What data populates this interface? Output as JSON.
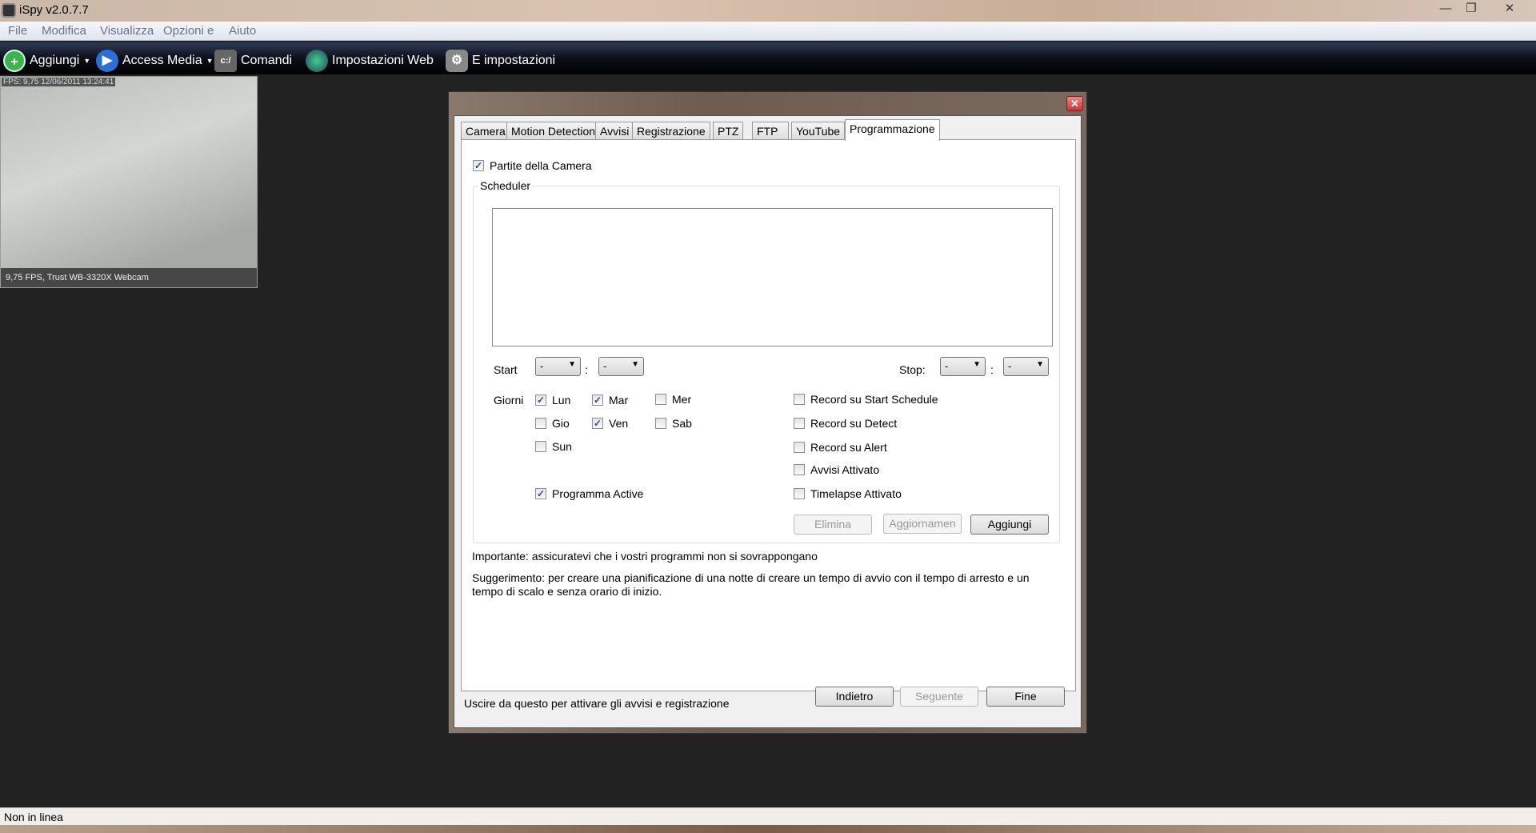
{
  "window": {
    "title": "iSpy v2.0.7.7",
    "minimize_icon": "minimize-icon",
    "maximize_icon": "maximize-icon",
    "close_icon": "close-icon"
  },
  "menu": [
    "File",
    "Modifica",
    "Visualizza",
    "Opzioni e",
    "Aiuto"
  ],
  "toolbar": [
    {
      "label": "Aggiungi",
      "icon": "plus-icon",
      "dropdown": true
    },
    {
      "label": "Access Media",
      "icon": "play-icon",
      "dropdown": true
    },
    {
      "label": "Comandi",
      "icon": "command-icon"
    },
    {
      "label": "Impostazioni Web",
      "icon": "globe-icon"
    },
    {
      "label": "E impostazioni",
      "icon": "gear-icon"
    }
  ],
  "camera": {
    "overlay": "FPS: 9,75 12/06/2011 13:24:41",
    "caption": "9,75 FPS, Trust WB-3320X Webcam"
  },
  "dialog": {
    "tabs": [
      "Camera",
      "Motion Detection",
      "Avvisi",
      "Registrazione",
      "PTZ",
      "FTP",
      "YouTube",
      "Programmazione"
    ],
    "active_tab": "Programmazione",
    "start_with_camera": {
      "label": "Partite della Camera",
      "checked": true
    },
    "scheduler": {
      "label": "Scheduler",
      "start_label": "Start",
      "stop_label": "Stop:",
      "separator": ":",
      "start_hour": "-",
      "start_min": "-",
      "stop_hour": "-",
      "stop_min": "-",
      "days_label": "Giorni",
      "days": [
        {
          "label": "Lun",
          "checked": true
        },
        {
          "label": "Mar",
          "checked": true
        },
        {
          "label": "Mer",
          "checked": false
        },
        {
          "label": "Gio",
          "checked": false
        },
        {
          "label": "Ven",
          "checked": true
        },
        {
          "label": "Sab",
          "checked": false
        },
        {
          "label": "Sun",
          "checked": false
        }
      ],
      "program_active": {
        "label": "Programma Active",
        "checked": true
      },
      "options": [
        {
          "label": "Record su Start Schedule",
          "checked": false
        },
        {
          "label": "Record su Detect",
          "checked": false
        },
        {
          "label": "Record su Alert",
          "checked": false
        },
        {
          "label": "Avvisi Attivato",
          "checked": false
        },
        {
          "label": "Timelapse Attivato",
          "checked": false
        }
      ],
      "buttons": {
        "delete": "Elimina",
        "update": "Aggiornamen",
        "add": "Aggiungi"
      }
    },
    "important": "Importante: assicuratevi che i vostri programmi non si sovrappongano",
    "hint_line1": "Suggerimento: per creare una pianificazione di una notte di creare un tempo di avvio con il tempo di arresto e un",
    "hint_line2": "tempo di scalo e senza orario di inizio.",
    "footer": "Uscire da questo per attivare gli avvisi e registrazione",
    "nav": {
      "back": "Indietro",
      "next": "Seguente",
      "finish": "Fine"
    }
  },
  "status": "Non in linea"
}
